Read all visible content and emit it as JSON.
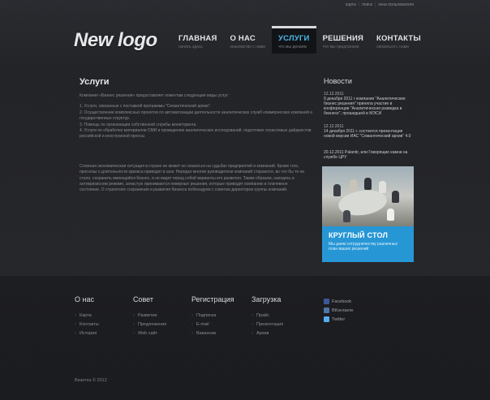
{
  "top_links": [
    "карта",
    "поиск",
    "зона пользователя"
  ],
  "logo": "New logo",
  "nav": [
    {
      "label": "ГЛАВНАЯ",
      "sub": "начать здесь"
    },
    {
      "label": "О НАС",
      "sub": "знакомство с нами"
    },
    {
      "label": "УСЛУГИ",
      "sub": "что мы делаем"
    },
    {
      "label": "РЕШЕНИЯ",
      "sub": "что мы предлагаем"
    },
    {
      "label": "КОНТАКТЫ",
      "sub": "связаться с нами"
    }
  ],
  "content": {
    "title": "Услуги",
    "intro": "Компания «Бизнес решения» предоставляет клиентам следующие виды услуг:",
    "items": [
      "1. Услуги, связанные с поставкой программы \"Семантический архив\".",
      "2. Осуществление комплексных проектов по автоматизации деятельности аналитических служб коммерческих компаний и государственных структур.",
      "3. Помощь по организации собственной службы мониторинга.",
      "4. Услуги по обработке материалов СМИ и проведению аналитических исследований, подготовке отраслевых дайджестов российской и иностранной прессы."
    ],
    "paragraph": "Сложная экономическая ситуация в стране не может не сказаться на судьбах предприятий и компаний. Кроме того, прогнозы о длительности кризиса приводят в шок. Нередко многие руководители компаний стараются, во что бы то ни стало, сохранить имеющийся бизнес, и не видят перед собой варианты его развития. Таким образом, находясь в антикризисном режиме, зачастую принимаются неверные решения, которые приводят компанию в плачевное состояние. О стратегиях сохранения и развития бизнеса побеседуем с советом директоров группы компаний."
  },
  "sidebar": {
    "title": "Новости",
    "news": [
      {
        "date": "12.12.2011",
        "text": "9 декабря 2011 г компания \"Аналитические бизнес решения\" приняла участие в конференции \"Аналитическая разведка в бизнесе\", прошедшей в МЭСИ"
      },
      {
        "date": "12.12.2011",
        "text": "14 декабря 2011 г. состоится презентация новой версии ИАС \"Семантический архив\" 4.0"
      },
      {
        "date": "",
        "text": "20.12.2011 Palantir, или Говорящие камни на службе ЦРУ"
      }
    ],
    "banner": {
      "title": "КРУГЛЫЙ СТОЛ",
      "text": "Мы даем сотрудничеству различных план ваших решений",
      "color": "#2796d5"
    }
  },
  "footer": {
    "columns": [
      {
        "title": "О нас",
        "links": [
          "Карта",
          "Контакты",
          "История"
        ]
      },
      {
        "title": "Совет",
        "links": [
          "Развитие",
          "Предложения",
          "Web сайт"
        ]
      },
      {
        "title": "Регистрация",
        "links": [
          "Подписка",
          "E-mail",
          "Вакансии"
        ]
      },
      {
        "title": "Загрузка",
        "links": [
          "Прайс",
          "Презентация",
          "Архив"
        ]
      }
    ],
    "social": [
      {
        "label": "Facebook",
        "icon": "facebook-icon",
        "color": "#3b5998"
      },
      {
        "label": "ВКонтакте",
        "icon": "vkontakte-icon",
        "color": "#4c75a3"
      },
      {
        "label": "Twitter",
        "icon": "twitter-icon",
        "color": "#55acee"
      }
    ],
    "copyright": "Визитка © 2012"
  }
}
